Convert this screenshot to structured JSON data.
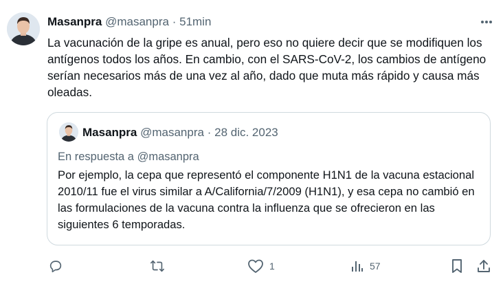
{
  "tweet": {
    "author_name": "Masanpra",
    "author_handle": "@masanpra",
    "separator": "·",
    "time": "51min",
    "text": "La vacunación de la gripe es anual, pero eso no quiere decir que se modifiquen los antígenos todos los años. En cambio, con el SARS-CoV-2, los cambios de antígeno serían necesarios más de una vez al año, dado que muta más rápido y causa más oleadas."
  },
  "quoted": {
    "author_name": "Masanpra",
    "author_handle": "@masanpra",
    "separator": "·",
    "date": "28 dic. 2023",
    "reply_to": "En respuesta a @masanpra",
    "text": "Por ejemplo, la cepa que representó el componente H1N1 de la vacuna estacional 2010/11 fue el virus similar a A/California/7/2009 (H1N1), y esa cepa no cambió en las formulaciones de la vacuna contra la influenza que se ofrecieron en las siguientes 6 temporadas."
  },
  "actions": {
    "reply_icon": "reply-icon",
    "retweet_icon": "retweet-icon",
    "like_icon": "heart-icon",
    "like_count": "1",
    "views_icon": "views-icon",
    "views_count": "57",
    "bookmark_icon": "bookmark-icon",
    "share_icon": "share-icon"
  },
  "colors": {
    "text": "#0f1419",
    "muted": "#536471",
    "border": "#cfd9de"
  }
}
